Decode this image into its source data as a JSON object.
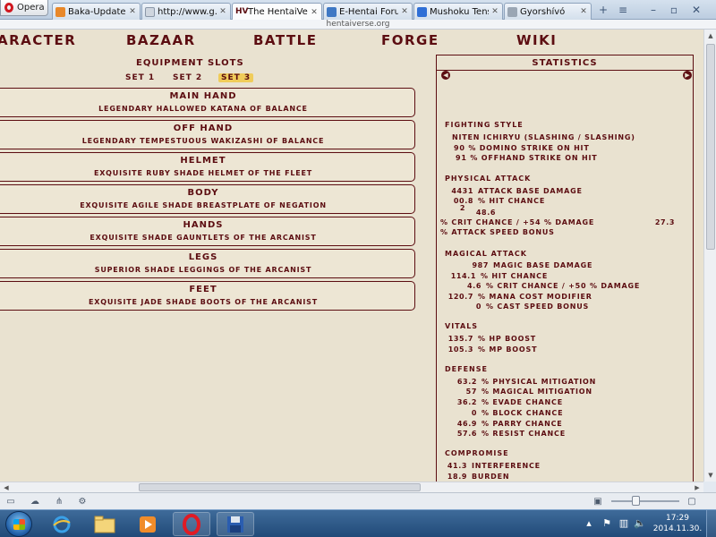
{
  "browser": {
    "menu_label": "Opera",
    "tabs": [
      {
        "title": "Baka-Updates ...",
        "favicon_color": "#e8882a",
        "active": false
      },
      {
        "title": "http://www.g...",
        "favicon_color": "#cfd6df",
        "active": false
      },
      {
        "title": "The HentaiVerse",
        "favicon_color": "#5c0d11",
        "active": true
      },
      {
        "title": "E-Hentai Foru...",
        "favicon_color": "#3f78c4",
        "active": false
      },
      {
        "title": "Mushoku Tens...",
        "favicon_color": "#2f6fd6",
        "active": false
      },
      {
        "title": "Gyorshívó",
        "favicon_color": "#9aa6b4",
        "active": false
      }
    ],
    "url": "hentaiverse.org"
  },
  "menu": [
    "aracter",
    "Bazaar",
    "Battle",
    "Forge",
    "Wiki"
  ],
  "equipment": {
    "title": "Equipment Slots",
    "sets": [
      "Set 1",
      "Set 2",
      "Set 3"
    ],
    "selected_set": "Set 3",
    "slots": [
      {
        "name": "Main Hand",
        "item": "Legendary Hallowed Katana of Balance"
      },
      {
        "name": "Off Hand",
        "item": "Legendary Tempestuous Wakizashi of Balance"
      },
      {
        "name": "Helmet",
        "item": "Exquisite Ruby Shade Helmet of the Fleet"
      },
      {
        "name": "Body",
        "item": "Exquisite Agile Shade Breastplate of Negation"
      },
      {
        "name": "Hands",
        "item": "Exquisite Shade Gauntlets of the Arcanist"
      },
      {
        "name": "Legs",
        "item": "Superior Shade Leggings of the Arcanist"
      },
      {
        "name": "Feet",
        "item": "Exquisite Jade Shade Boots of the Arcanist"
      }
    ]
  },
  "statistics": {
    "title": "Statistics",
    "fighting_style": {
      "title": "Fighting Style",
      "name": "Niten Ichiryu (Slashing / Slashing)",
      "lines": [
        "90 % Domino Strike on hit",
        "91 % Offhand Strike on hit"
      ]
    },
    "physical_attack": {
      "title": "Physical Attack",
      "base_damage": "4431",
      "base_damage_label": "Attack Base Damage",
      "hit_chance": "00.8",
      "hit_chance_label": "% Hit Chance",
      "stray_num_1": "2",
      "stray_num_2": "48.6",
      "crit_label": "% Crit Chance / +54 % Damage",
      "crit_value": "27.3",
      "speed_label": "% Attack Speed Bonus"
    },
    "magical_attack": {
      "title": "Magical Attack",
      "rows": [
        {
          "value": "987",
          "label": "Magic Base Damage"
        },
        {
          "value": "114.1",
          "label": "% Hit Chance"
        },
        {
          "value": "4.6",
          "label": "% Crit Chance / +50 % Damage"
        },
        {
          "value": "120.7",
          "label": "% Mana Cost Modifier"
        },
        {
          "value": "0",
          "label": "% Cast Speed Bonus"
        }
      ]
    },
    "vitals": {
      "title": "Vitals",
      "rows": [
        {
          "value": "135.7",
          "label": "% HP Boost"
        },
        {
          "value": "105.3",
          "label": "% MP Boost"
        }
      ]
    },
    "defense": {
      "title": "Defense",
      "rows": [
        {
          "value": "63.2",
          "label": "% Physical Mitigation"
        },
        {
          "value": "57",
          "label": "% Magical Mitigation"
        },
        {
          "value": "36.2",
          "label": "% Evade Chance"
        },
        {
          "value": "0",
          "label": "% Block Chance"
        },
        {
          "value": "46.9",
          "label": "% Parry Chance"
        },
        {
          "value": "57.6",
          "label": "% Resist Chance"
        }
      ]
    },
    "compromise": {
      "title": "Compromise",
      "rows": [
        {
          "value": "41.3",
          "label": "Interference"
        },
        {
          "value": "18.9",
          "label": "Burden"
        }
      ]
    }
  },
  "taskbar": {
    "time": "17:29",
    "date": "2014.11.30."
  }
}
